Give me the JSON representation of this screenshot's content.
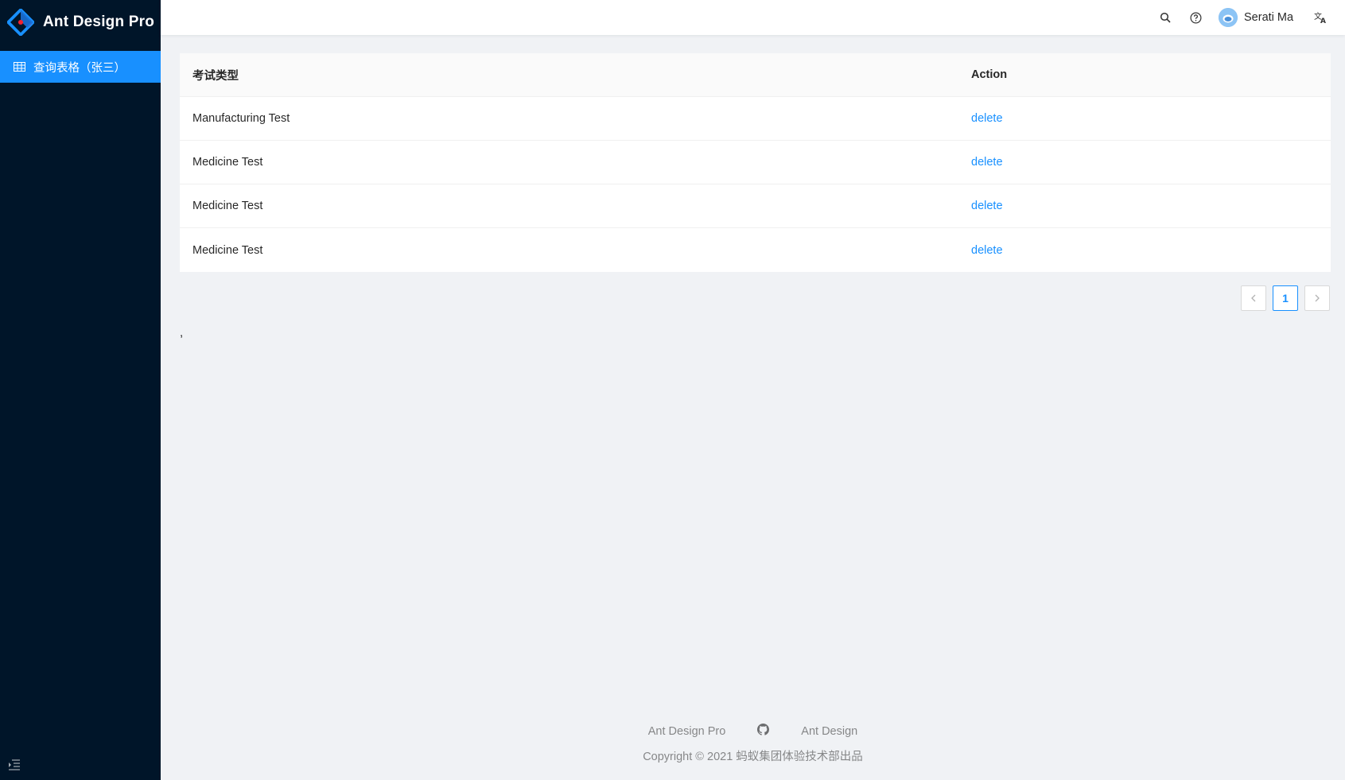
{
  "app": {
    "title": "Ant Design Pro"
  },
  "sidebar": {
    "items": [
      {
        "label": "查询表格（张三）",
        "icon": "table-icon",
        "active": true
      }
    ],
    "collapse_icon": "menu-fold-icon"
  },
  "header": {
    "icons": [
      "search-icon",
      "question-circle-icon",
      "translation-icon"
    ],
    "user": {
      "name": "Serati Ma",
      "avatar_icon": "avatar"
    }
  },
  "table": {
    "columns": [
      "考试类型",
      "Action"
    ],
    "rows": [
      {
        "type": "Manufacturing Test",
        "action": "delete"
      },
      {
        "type": "Medicine Test",
        "action": "delete"
      },
      {
        "type": "Medicine Test",
        "action": "delete"
      },
      {
        "type": "Medicine Test",
        "action": "delete"
      }
    ]
  },
  "pagination": {
    "prev_icon": "left-arrow-icon",
    "current": "1",
    "next_icon": "right-arrow-icon"
  },
  "stray_text": ",",
  "footer": {
    "links": [
      "Ant Design Pro",
      "Ant Design"
    ],
    "github_icon": "github-icon",
    "copyright": "Copyright © 2021 蚂蚁集团体验技术部出品"
  },
  "colors": {
    "sidebar_bg": "#001529",
    "primary": "#1890ff",
    "content_bg": "#f0f2f5"
  }
}
